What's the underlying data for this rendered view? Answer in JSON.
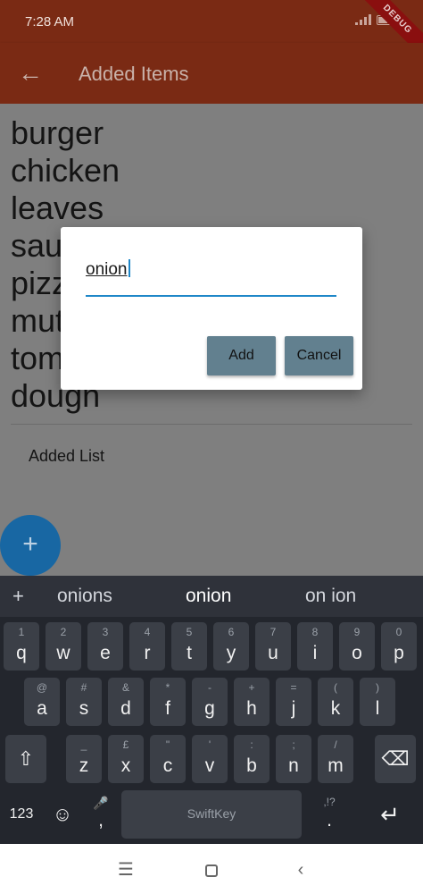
{
  "status_bar": {
    "time": "7:28 AM",
    "battery_level": 0.6,
    "debug_label": "DEBUG"
  },
  "app_bar": {
    "back_icon": "arrow-left-icon",
    "title": "Added Items"
  },
  "content": {
    "items": [
      "burger",
      "chicken",
      "leaves",
      "sau",
      "pizz",
      "mut",
      "tom",
      "dougn"
    ],
    "added_list_label": "Added List",
    "fab_label": "+"
  },
  "dialog": {
    "input_value": "onion",
    "add_label": "Add",
    "cancel_label": "Cancel",
    "button_color": "#62808f",
    "underline_color": "#1f87c8"
  },
  "keyboard": {
    "suggestions": {
      "plus": "+",
      "items": [
        "onions",
        "onion",
        "on ion"
      ]
    },
    "row1": [
      {
        "sub": "1",
        "main": "q"
      },
      {
        "sub": "2",
        "main": "w"
      },
      {
        "sub": "3",
        "main": "e"
      },
      {
        "sub": "4",
        "main": "r"
      },
      {
        "sub": "5",
        "main": "t"
      },
      {
        "sub": "6",
        "main": "y"
      },
      {
        "sub": "7",
        "main": "u"
      },
      {
        "sub": "8",
        "main": "i"
      },
      {
        "sub": "9",
        "main": "o"
      },
      {
        "sub": "0",
        "main": "p"
      }
    ],
    "row2": [
      {
        "sub": "@",
        "main": "a"
      },
      {
        "sub": "#",
        "main": "s"
      },
      {
        "sub": "&",
        "main": "d"
      },
      {
        "sub": "*",
        "main": "f"
      },
      {
        "sub": "-",
        "main": "g"
      },
      {
        "sub": "+",
        "main": "h"
      },
      {
        "sub": "=",
        "main": "j"
      },
      {
        "sub": "(",
        "main": "k"
      },
      {
        "sub": ")",
        "main": "l"
      }
    ],
    "row3": [
      {
        "sub": "_",
        "main": "z"
      },
      {
        "sub": "£",
        "main": "x"
      },
      {
        "sub": "\"",
        "main": "c"
      },
      {
        "sub": "'",
        "main": "v"
      },
      {
        "sub": ":",
        "main": "b"
      },
      {
        "sub": ";",
        "main": "n"
      },
      {
        "sub": "/",
        "main": "m"
      }
    ],
    "shift_icon": "shift-icon",
    "backspace_icon": "backspace-icon",
    "numbers_label": "123",
    "emoji_icon": "emoji-icon",
    "comma": {
      "sub": "🎤",
      "main": ","
    },
    "space_label": "SwiftKey",
    "period": {
      "sub": ",!?",
      "main": "."
    },
    "enter_icon": "enter-icon"
  },
  "nav_bar": {
    "menu_icon": "menu-icon",
    "home_icon": "home-icon",
    "back_icon": "back-chevron-icon"
  }
}
